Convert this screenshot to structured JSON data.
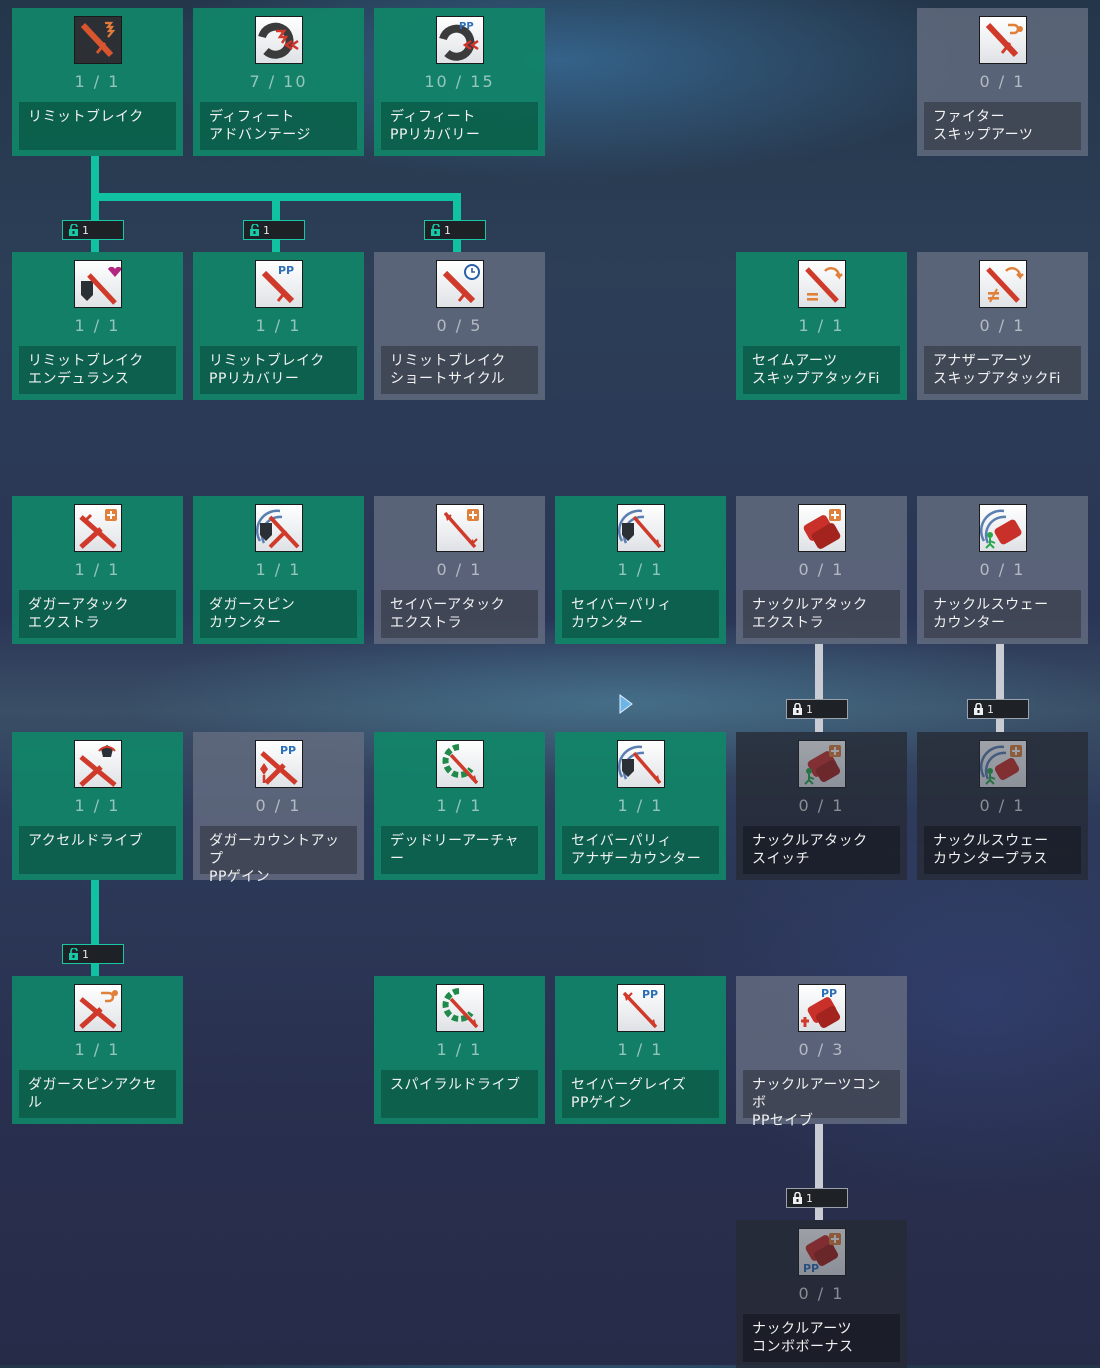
{
  "colors": {
    "learned": "#118468",
    "unlearned": "#646c80",
    "locked": "#262a34",
    "connector_active": "#11c2a1",
    "connector_locked": "#c9cdd3"
  },
  "skills": [
    {
      "id": "limit-break",
      "name": "リミットブレイク",
      "level": "1 / 1",
      "state": "learned",
      "icon": "sword-fire-icon"
    },
    {
      "id": "defeat-advantage",
      "name": "ディフィート\nアドバンテージ",
      "level": "7 / 10",
      "state": "learned",
      "icon": "defeat-chevron-icon"
    },
    {
      "id": "defeat-pp-recovery",
      "name": "ディフィート\nPPリカバリー",
      "level": "10 / 15",
      "state": "learned",
      "icon": "defeat-pp-icon"
    },
    {
      "id": "fighter-skip-arts",
      "name": "ファイター\nスキップアーツ",
      "level": "0 / 1",
      "state": "unlearned",
      "icon": "sword-skip-icon"
    },
    {
      "id": "limit-break-endurance",
      "name": "リミットブレイク\nエンデュランス",
      "level": "1 / 1",
      "state": "learned",
      "icon": "sword-heart-icon"
    },
    {
      "id": "limit-break-pp-recovery",
      "name": "リミットブレイク\nPPリカバリー",
      "level": "1 / 1",
      "state": "learned",
      "icon": "sword-pp-icon"
    },
    {
      "id": "limit-break-short-cycle",
      "name": "リミットブレイク\nショートサイクル",
      "level": "0 / 5",
      "state": "unlearned",
      "icon": "sword-clock-icon"
    },
    {
      "id": "same-arts-skip-attack",
      "name": "セイムアーツ\nスキップアタックFi",
      "level": "1 / 1",
      "state": "learned",
      "icon": "sword-equal-icon"
    },
    {
      "id": "another-arts-skip-attack",
      "name": "アナザーアーツ\nスキップアタックFi",
      "level": "0 / 1",
      "state": "unlearned",
      "icon": "sword-notequal-icon"
    },
    {
      "id": "dagger-attack-extra",
      "name": "ダガーアタック\nエクストラ",
      "level": "1 / 1",
      "state": "learned",
      "icon": "dagger-plus-icon"
    },
    {
      "id": "dagger-spin-counter",
      "name": "ダガースピン\nカウンター",
      "level": "1 / 1",
      "state": "learned",
      "icon": "dagger-shield-icon"
    },
    {
      "id": "saber-attack-extra",
      "name": "セイバーアタック\nエクストラ",
      "level": "0 / 1",
      "state": "unlearned",
      "icon": "saber-plus-icon"
    },
    {
      "id": "saber-parry-counter",
      "name": "セイバーパリィ\nカウンター",
      "level": "1 / 1",
      "state": "learned",
      "icon": "saber-shield-icon"
    },
    {
      "id": "knuckle-attack-extra",
      "name": "ナックルアタック\nエクストラ",
      "level": "0 / 1",
      "state": "unlearned",
      "icon": "knuckle-plus-icon"
    },
    {
      "id": "knuckle-sway-counter",
      "name": "ナックルスウェー\nカウンター",
      "level": "0 / 1",
      "state": "unlearned",
      "icon": "knuckle-sway-icon"
    },
    {
      "id": "accel-drive",
      "name": "アクセルドライブ",
      "level": "1 / 1",
      "state": "learned",
      "icon": "dagger-accel-icon"
    },
    {
      "id": "dagger-countup-pp-gain",
      "name": "ダガーカウントアップ\nPPゲイン",
      "level": "0 / 1",
      "state": "unlearned",
      "icon": "dagger-pp-icon"
    },
    {
      "id": "deadly-archer",
      "name": "デッドリーアーチャー",
      "level": "1 / 1",
      "state": "learned",
      "icon": "saber-spiral-icon"
    },
    {
      "id": "saber-parry-another-counter",
      "name": "セイバーパリィ\nアナザーカウンター",
      "level": "1 / 1",
      "state": "learned",
      "icon": "saber-shield-icon"
    },
    {
      "id": "knuckle-attack-switch",
      "name": "ナックルアタック\nスイッチ",
      "level": "0 / 1",
      "state": "locked",
      "icon": "knuckle-switch-icon"
    },
    {
      "id": "knuckle-sway-counter-plus",
      "name": "ナックルスウェー\nカウンタープラス",
      "level": "0 / 1",
      "state": "locked",
      "icon": "knuckle-sway-plus-icon"
    },
    {
      "id": "dagger-spin-accel",
      "name": "ダガースピンアクセル",
      "level": "1 / 1",
      "state": "learned",
      "icon": "dagger-skip-icon"
    },
    {
      "id": "spiral-drive",
      "name": "スパイラルドライブ",
      "level": "1 / 1",
      "state": "learned",
      "icon": "saber-spiral-icon"
    },
    {
      "id": "saber-graze-pp-gain",
      "name": "セイバーグレイズ\nPPゲイン",
      "level": "1 / 1",
      "state": "learned",
      "icon": "saber-pp-icon"
    },
    {
      "id": "knuckle-arts-combo-pp-save",
      "name": "ナックルアーツコンボ\nPPセイブ",
      "level": "0 / 3",
      "state": "unlearned",
      "icon": "knuckle-pp-save-icon"
    },
    {
      "id": "knuckle-arts-combo-bonus",
      "name": "ナックルアーツ\nコンボボーナス",
      "level": "0 / 1",
      "state": "locked",
      "icon": "knuckle-pp-bonus-icon"
    }
  ],
  "requirements": [
    {
      "id": "req-limit-break-endurance",
      "level": "1",
      "state": "met"
    },
    {
      "id": "req-limit-break-pp-recovery",
      "level": "1",
      "state": "met"
    },
    {
      "id": "req-limit-break-short-cycle",
      "level": "1",
      "state": "met"
    },
    {
      "id": "req-knuckle-attack-switch",
      "level": "1",
      "state": "unmet"
    },
    {
      "id": "req-knuckle-sway-counter-plus",
      "level": "1",
      "state": "unmet"
    },
    {
      "id": "req-dagger-spin-accel",
      "level": "1",
      "state": "met"
    },
    {
      "id": "req-knuckle-arts-combo-bonus",
      "level": "1",
      "state": "unmet"
    }
  ]
}
